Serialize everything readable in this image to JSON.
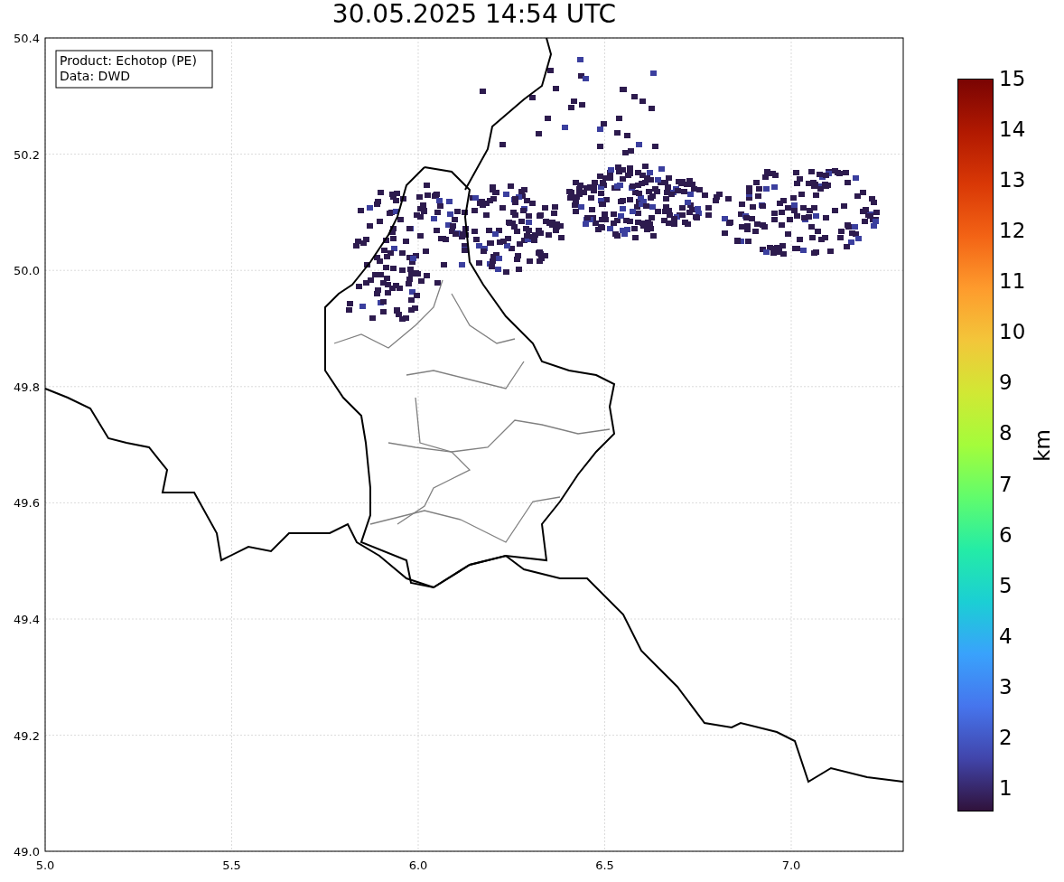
{
  "title": "30.05.2025 14:54 UTC",
  "legend": [
    "Product: Echotop (PE)",
    "Data: DWD"
  ],
  "x_ticks": [
    "5.0",
    "5.5",
    "6.0",
    "6.5",
    "7.0"
  ],
  "y_ticks": [
    "50.4",
    "50.2",
    "50.0",
    "49.8",
    "49.6",
    "49.4",
    "49.2",
    "49.0"
  ],
  "colorbar": {
    "label": "km",
    "ticks": [
      "15",
      "14",
      "13",
      "12",
      "11",
      "10",
      "9",
      "8",
      "7",
      "6",
      "5",
      "4",
      "3",
      "2",
      "1"
    ]
  }
}
